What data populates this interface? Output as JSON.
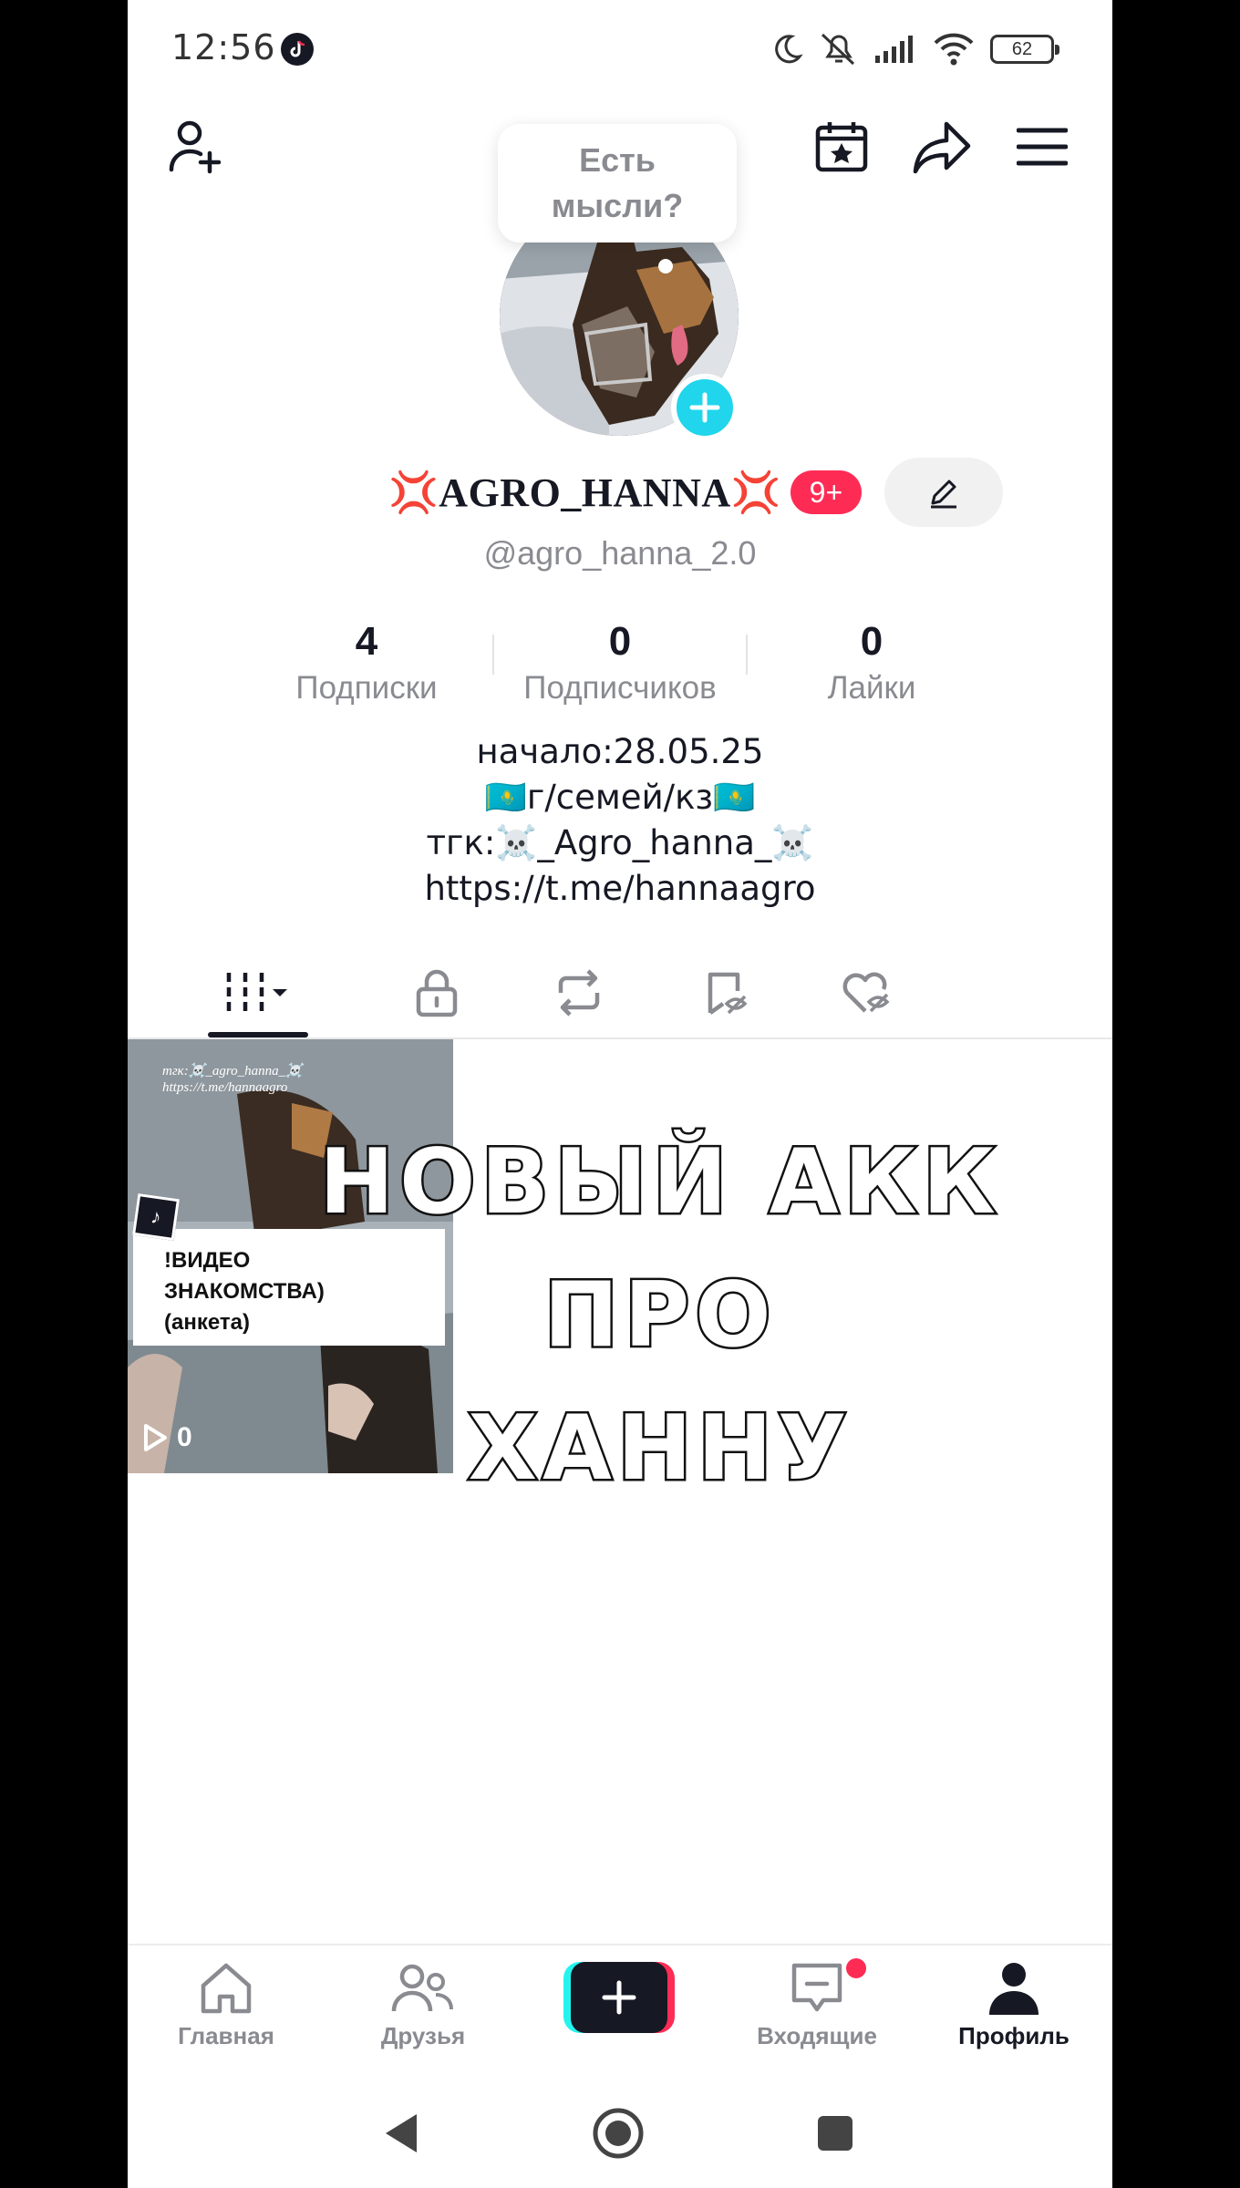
{
  "status_bar": {
    "time": "12:56",
    "battery": "62",
    "icons": [
      "tiktok-icon",
      "moon-icon",
      "silent-icon",
      "signal-icon",
      "wifi-icon",
      "battery-icon"
    ]
  },
  "header": {
    "thought_bubble": {
      "line1": "Есть",
      "line2": "мысли?"
    }
  },
  "profile": {
    "name_core": "AGRO_HANNA",
    "name_emoji": "💢",
    "notification_badge": "9+",
    "handle": "@agro_hanna_2.0",
    "stats": [
      {
        "value": "4",
        "label": "Подписки"
      },
      {
        "value": "0",
        "label": "Подписчиков"
      },
      {
        "value": "0",
        "label": "Лайки"
      }
    ],
    "bio": [
      "начало:28.05.25",
      "🇰🇿г/семей/кз🇰🇿",
      "тгк:☠️_Agro_hanna_☠️",
      "https://t.me/hannaagro"
    ]
  },
  "tabs": [
    "videos-tab",
    "private-tab",
    "reposts-tab",
    "favorites-tab",
    "liked-tab"
  ],
  "videos": [
    {
      "top_text_1": "тгк:☠️_agro_hanna_☠️",
      "top_text_2": "https://t.me/hannaagro",
      "caption": [
        "!ВИДЕО",
        "ЗНАКОМСТВА)",
        "(анкета)"
      ],
      "plays": "0"
    }
  ],
  "overlay_title": [
    "НОВЫЙ АКК ПРО",
    "ХАННУ"
  ],
  "bottom_nav": {
    "items": [
      {
        "label": "Главная"
      },
      {
        "label": "Друзья"
      },
      {
        "label": "Входящие"
      },
      {
        "label": "Профиль"
      }
    ]
  },
  "colors": {
    "accent_red": "#fe2c55",
    "accent_cyan": "#25f4ee",
    "text": "#161823",
    "muted": "#8a8b91"
  }
}
